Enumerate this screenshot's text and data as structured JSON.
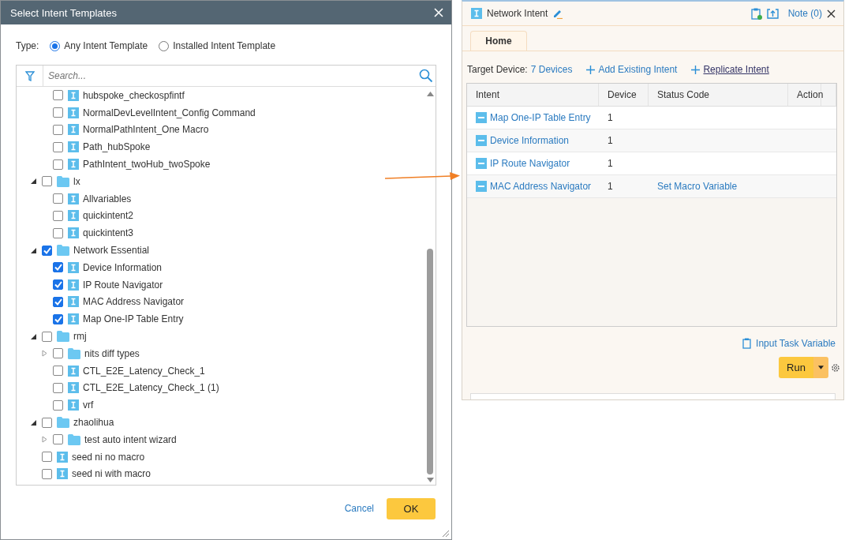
{
  "dialog": {
    "title": "Select Intent Templates",
    "type_label": "Type:",
    "type_options": [
      {
        "label": "Any Intent Template",
        "selected": true
      },
      {
        "label": "Installed Intent Template",
        "selected": false
      }
    ],
    "search": {
      "placeholder": "Search..."
    },
    "tree": {
      "items": [
        {
          "children": [
            {
              "kind": "intent",
              "label": "hubspoke_checkospfintf",
              "checked": false
            },
            {
              "kind": "intent",
              "label": "NormalDevLevelIntent_Config Command",
              "checked": false
            },
            {
              "kind": "intent",
              "label": "NormalPathIntent_One Macro",
              "checked": false
            },
            {
              "kind": "intent",
              "label": "Path_hubSpoke",
              "checked": false
            },
            {
              "kind": "intent",
              "label": "PathIntent_twoHub_twoSpoke",
              "checked": false
            }
          ]
        },
        {
          "kind": "folder",
          "label": "lx",
          "checked": false,
          "expanded": true,
          "children": [
            {
              "kind": "intent",
              "label": "Allvariables",
              "checked": false
            },
            {
              "kind": "intent",
              "label": "quickintent2",
              "checked": false
            },
            {
              "kind": "intent",
              "label": "quickintent3",
              "checked": false
            }
          ]
        },
        {
          "kind": "folder",
          "label": "Network Essential",
          "checked": true,
          "expanded": true,
          "children": [
            {
              "kind": "intent",
              "label": "Device Information",
              "checked": true
            },
            {
              "kind": "intent",
              "label": "IP Route Navigator",
              "checked": true
            },
            {
              "kind": "intent",
              "label": "MAC Address Navigator",
              "checked": true
            },
            {
              "kind": "intent",
              "label": "Map One-IP Table Entry",
              "checked": true
            }
          ]
        },
        {
          "kind": "folder",
          "label": "rmj",
          "checked": false,
          "expanded": true,
          "children": [
            {
              "kind": "folder",
              "label": "nits diff types",
              "checked": false,
              "expanded": false
            },
            {
              "kind": "intent",
              "label": "CTL_E2E_Latency_Check_1",
              "checked": false
            },
            {
              "kind": "intent",
              "label": "CTL_E2E_Latency_Check_1 (1)",
              "checked": false
            },
            {
              "kind": "intent",
              "label": "vrf",
              "checked": false
            }
          ]
        },
        {
          "kind": "folder",
          "label": "zhaolihua",
          "checked": false,
          "expanded": true,
          "children": [
            {
              "kind": "folder",
              "label": "test auto intent wizard",
              "checked": false,
              "expanded": false
            }
          ]
        },
        {
          "kind": "intent",
          "label": "seed ni no macro",
          "checked": false
        },
        {
          "kind": "intent",
          "label": "seed ni with macro",
          "checked": false
        }
      ]
    },
    "buttons": {
      "cancel": "Cancel",
      "ok": "OK"
    }
  },
  "panel": {
    "title": "Network Intent",
    "note": "Note (0)",
    "tabs": [
      {
        "label": "Home",
        "selected": true
      }
    ],
    "target_label": "Target Device:",
    "target_value": "7 Devices",
    "actions": [
      "Add Existing Intent",
      "Replicate Intent"
    ],
    "table": {
      "columns": [
        "Intent",
        "Device",
        "Status Code",
        "Action"
      ],
      "rows": [
        {
          "intent": "Map One-IP Table Entry",
          "device": "1"
        },
        {
          "intent": "Device Information",
          "device": "1"
        },
        {
          "intent": "IP Route Navigator",
          "device": "1"
        },
        {
          "intent": "MAC Address Navigator",
          "device": "1",
          "status": "Set Macro Variable"
        }
      ]
    },
    "input_task_variable": "Input Task Variable",
    "run": "Run"
  }
}
